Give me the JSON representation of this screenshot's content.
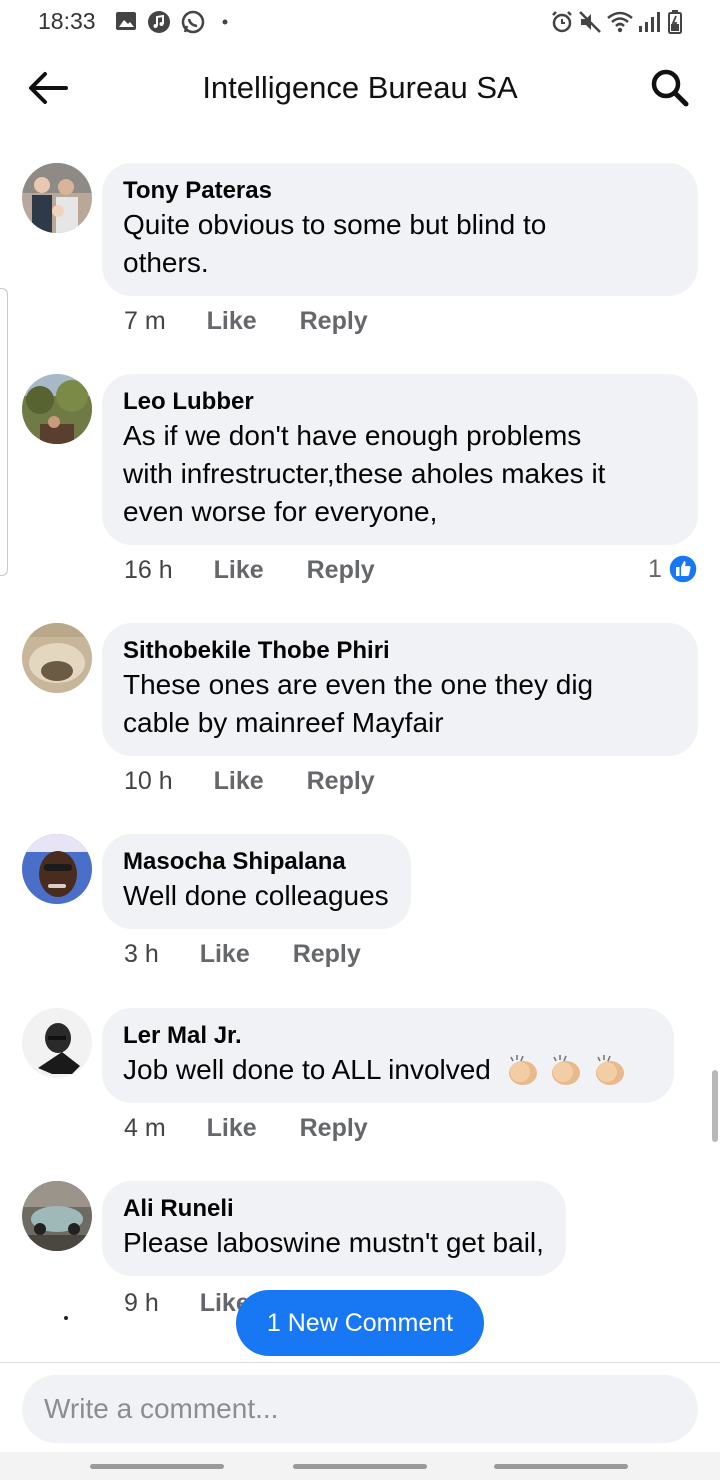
{
  "status_bar": {
    "time": "18:33"
  },
  "header": {
    "title": "Intelligence Bureau SA"
  },
  "comments": [
    {
      "author": "Tony Pateras",
      "lines": [
        "Quite obvious to some but blind to",
        "others."
      ],
      "time": "7 m",
      "like": "Like",
      "reply": "Reply"
    },
    {
      "author": "Leo Lubber",
      "lines": [
        "As if we don't have enough problems",
        "with infrestructer,these aholes makes it",
        "even worse for everyone,"
      ],
      "time": "16 h",
      "like": "Like",
      "reply": "Reply",
      "reaction_count": "1"
    },
    {
      "author": "Sithobekile Thobe Phiri",
      "lines": [
        "These ones are even the one they dig",
        "cable by mainreef Mayfair"
      ],
      "time": "10 h",
      "like": "Like",
      "reply": "Reply"
    },
    {
      "author": "Masocha Shipalana",
      "lines": [
        "Well done colleagues"
      ],
      "time": "3 h",
      "like": "Like",
      "reply": "Reply"
    },
    {
      "author": "Ler Mal Jr.",
      "lines": [
        "Job well done to ALL involved"
      ],
      "time": "4 m",
      "like": "Like",
      "reply": "Reply"
    },
    {
      "author": "Ali Runeli",
      "lines": [
        "Please laboswine mustn't get bail,"
      ],
      "time": "9 h",
      "like": "Like"
    }
  ],
  "new_comment_button": "1 New Comment",
  "composer": {
    "placeholder": "Write a comment..."
  },
  "colors": {
    "accent": "#1877f2",
    "bubble": "#f0f2f5",
    "meta_text": "#65676b"
  }
}
